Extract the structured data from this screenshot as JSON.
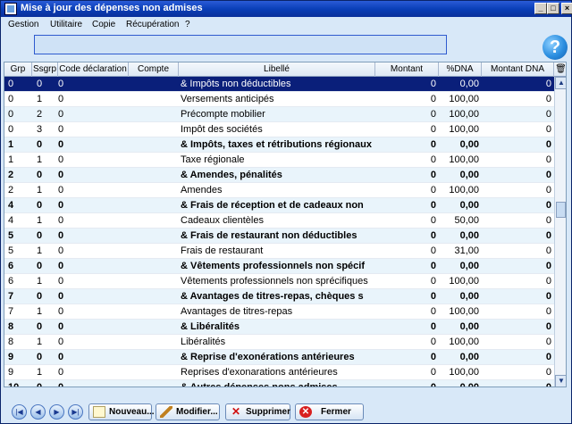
{
  "window": {
    "title": "Mise à jour  des dépenses non admises"
  },
  "window_buttons": [
    "_",
    "□",
    "×"
  ],
  "menu": [
    "Gestion",
    "Utilitaire",
    "Copie",
    "Récupération",
    "?"
  ],
  "help_glyph": "?",
  "columns": [
    "Grp",
    "Ssgrp",
    "Code déclaration",
    "Compte",
    "Libellé",
    "Montant",
    "%DNA",
    "Montant DNA"
  ],
  "rows": [
    {
      "grp": "0",
      "ssgrp": "0",
      "code": "0",
      "compte": "",
      "libelle": "& Impôts non déductibles",
      "montant": "0",
      "dna": "0,00",
      "montant_dna": "0",
      "style": "sel"
    },
    {
      "grp": "0",
      "ssgrp": "1",
      "code": "0",
      "compte": "",
      "libelle": "Versements anticipés",
      "montant": "0",
      "dna": "100,00",
      "montant_dna": "0",
      "style": ""
    },
    {
      "grp": "0",
      "ssgrp": "2",
      "code": "0",
      "compte": "",
      "libelle": "Précompte mobilier",
      "montant": "0",
      "dna": "100,00",
      "montant_dna": "0",
      "style": "alt"
    },
    {
      "grp": "0",
      "ssgrp": "3",
      "code": "0",
      "compte": "",
      "libelle": "Impôt des sociétés",
      "montant": "0",
      "dna": "100,00",
      "montant_dna": "0",
      "style": ""
    },
    {
      "grp": "1",
      "ssgrp": "0",
      "code": "0",
      "compte": "",
      "libelle": "& Impôts, taxes et rétributions régionaux",
      "montant": "0",
      "dna": "0,00",
      "montant_dna": "0",
      "style": "alt bold"
    },
    {
      "grp": "1",
      "ssgrp": "1",
      "code": "0",
      "compte": "",
      "libelle": "Taxe régionale",
      "montant": "0",
      "dna": "100,00",
      "montant_dna": "0",
      "style": ""
    },
    {
      "grp": "2",
      "ssgrp": "0",
      "code": "0",
      "compte": "",
      "libelle": "& Amendes, pénalités",
      "montant": "0",
      "dna": "0,00",
      "montant_dna": "0",
      "style": "alt bold"
    },
    {
      "grp": "2",
      "ssgrp": "1",
      "code": "0",
      "compte": "",
      "libelle": "Amendes",
      "montant": "0",
      "dna": "100,00",
      "montant_dna": "0",
      "style": ""
    },
    {
      "grp": "4",
      "ssgrp": "0",
      "code": "0",
      "compte": "",
      "libelle": "& Frais de réception et de cadeaux non",
      "montant": "0",
      "dna": "0,00",
      "montant_dna": "0",
      "style": "alt bold"
    },
    {
      "grp": "4",
      "ssgrp": "1",
      "code": "0",
      "compte": "",
      "libelle": "Cadeaux clientèles",
      "montant": "0",
      "dna": "50,00",
      "montant_dna": "0",
      "style": ""
    },
    {
      "grp": "5",
      "ssgrp": "0",
      "code": "0",
      "compte": "",
      "libelle": "& Frais de restaurant non déductibles",
      "montant": "0",
      "dna": "0,00",
      "montant_dna": "0",
      "style": "alt bold"
    },
    {
      "grp": "5",
      "ssgrp": "1",
      "code": "0",
      "compte": "",
      "libelle": "Frais de restaurant",
      "montant": "0",
      "dna": "31,00",
      "montant_dna": "0",
      "style": ""
    },
    {
      "grp": "6",
      "ssgrp": "0",
      "code": "0",
      "compte": "",
      "libelle": "& Vêtements professionnels non spécif",
      "montant": "0",
      "dna": "0,00",
      "montant_dna": "0",
      "style": "alt bold"
    },
    {
      "grp": "6",
      "ssgrp": "1",
      "code": "0",
      "compte": "",
      "libelle": "Vêtements professionnels non sprécifiques",
      "montant": "0",
      "dna": "100,00",
      "montant_dna": "0",
      "style": ""
    },
    {
      "grp": "7",
      "ssgrp": "0",
      "code": "0",
      "compte": "",
      "libelle": "& Avantages de titres-repas, chèques s",
      "montant": "0",
      "dna": "0,00",
      "montant_dna": "0",
      "style": "alt bold"
    },
    {
      "grp": "7",
      "ssgrp": "1",
      "code": "0",
      "compte": "",
      "libelle": "Avantages de titres-repas",
      "montant": "0",
      "dna": "100,00",
      "montant_dna": "0",
      "style": ""
    },
    {
      "grp": "8",
      "ssgrp": "0",
      "code": "0",
      "compte": "",
      "libelle": "& Libéralités",
      "montant": "0",
      "dna": "0,00",
      "montant_dna": "0",
      "style": "alt bold"
    },
    {
      "grp": "8",
      "ssgrp": "1",
      "code": "0",
      "compte": "",
      "libelle": "Libéralités",
      "montant": "0",
      "dna": "100,00",
      "montant_dna": "0",
      "style": ""
    },
    {
      "grp": "9",
      "ssgrp": "0",
      "code": "0",
      "compte": "",
      "libelle": "& Reprise d'exonérations antérieures",
      "montant": "0",
      "dna": "0,00",
      "montant_dna": "0",
      "style": "alt bold"
    },
    {
      "grp": "9",
      "ssgrp": "1",
      "code": "0",
      "compte": "",
      "libelle": "Reprises d'exonarations antérieures",
      "montant": "0",
      "dna": "100,00",
      "montant_dna": "0",
      "style": ""
    },
    {
      "grp": "10",
      "ssgrp": "0",
      "code": "0",
      "compte": "",
      "libelle": "& Autres dépenses nons admises",
      "montant": "0",
      "dna": "0,00",
      "montant_dna": "0",
      "style": "alt bold"
    }
  ],
  "nav_buttons": [
    "|◀",
    "◀",
    "▶",
    "▶|"
  ],
  "actions": {
    "nouveau": "Nouveau...",
    "modifier": "Modifier...",
    "supprimer": "Supprimer",
    "fermer": "Fermer"
  },
  "icons": {
    "delete_glyph": "✕",
    "close_glyph": "✕"
  },
  "colors": {
    "selection": "#0a1f7a",
    "titlebar": "#0a3fb8",
    "row_alt": "#e9f4fb"
  }
}
